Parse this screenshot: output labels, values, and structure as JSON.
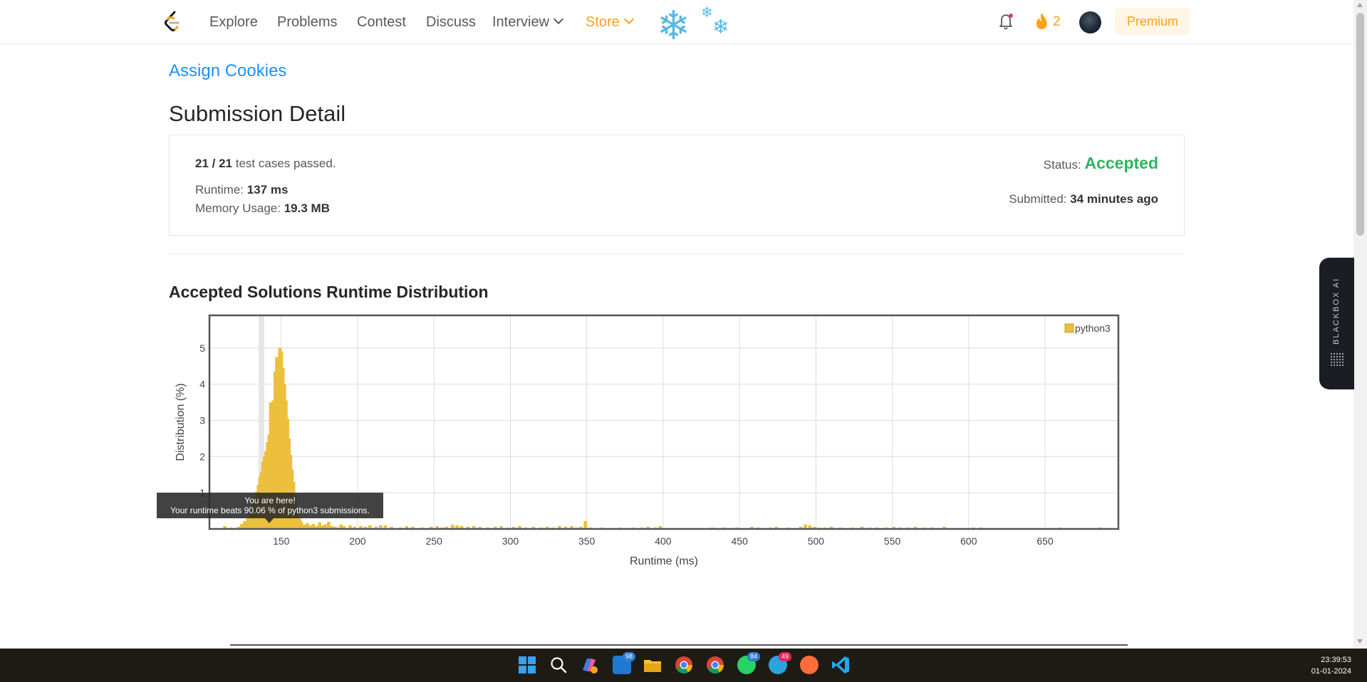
{
  "nav": {
    "items": [
      "Explore",
      "Problems",
      "Contest",
      "Discuss",
      "Interview",
      "Store"
    ],
    "streak": "2",
    "premium": "Premium",
    "store_color": "#ffa116"
  },
  "submission": {
    "problem": "Assign Cookies",
    "title": "Submission Detail",
    "passed": "21 / 21",
    "passed_suffix": "test cases passed.",
    "runtime_label": "Runtime:",
    "runtime_value": "137 ms",
    "memory_label": "Memory Usage:",
    "memory_value": "19.3 MB",
    "status_label": "Status:",
    "status_value": "Accepted",
    "submitted_label": "Submitted:",
    "submitted_value": "34 minutes ago"
  },
  "section_title": "Accepted Solutions Runtime Distribution",
  "tooltip": {
    "line1": "You are here!",
    "line2": "Your runtime beats 90.06 % of python3 submissions."
  },
  "chart_data": {
    "type": "bar",
    "xlabel": "Runtime (ms)",
    "ylabel": "Distribution (%)",
    "xlim": [
      103,
      698
    ],
    "ylim": [
      0,
      5.9
    ],
    "xticks": [
      150,
      200,
      250,
      300,
      350,
      400,
      450,
      500,
      550,
      600,
      650
    ],
    "yticks": [
      1,
      2,
      3,
      4,
      5
    ],
    "grid": true,
    "legend": "top-right",
    "series": [
      {
        "name": "python3",
        "color": "#ecbf3c"
      }
    ],
    "highlight_x": 137,
    "bar_width": 2,
    "points": [
      [
        113,
        0.08
      ],
      [
        117,
        0.04
      ],
      [
        122,
        0.06
      ],
      [
        124,
        0.14
      ],
      [
        125,
        0.1
      ],
      [
        126,
        0.22
      ],
      [
        128,
        0.3
      ],
      [
        130,
        0.42
      ],
      [
        131,
        0.6
      ],
      [
        132,
        0.72
      ],
      [
        133,
        0.88
      ],
      [
        134,
        1.04
      ],
      [
        135,
        1.22
      ],
      [
        136,
        1.45
      ],
      [
        137,
        1.58
      ],
      [
        138,
        1.85
      ],
      [
        139,
        2.0
      ],
      [
        140,
        2.15
      ],
      [
        141,
        2.4
      ],
      [
        142,
        2.6
      ],
      [
        143,
        3.5
      ],
      [
        144,
        3.1
      ],
      [
        145,
        3.55
      ],
      [
        146,
        4.35
      ],
      [
        147,
        4.75
      ],
      [
        148,
        4.6
      ],
      [
        149,
        5.0
      ],
      [
        150,
        4.9
      ],
      [
        151,
        4.45
      ],
      [
        152,
        4.0
      ],
      [
        153,
        3.55
      ],
      [
        154,
        3.05
      ],
      [
        155,
        2.5
      ],
      [
        156,
        2.05
      ],
      [
        157,
        1.65
      ],
      [
        158,
        1.3
      ],
      [
        159,
        0.95
      ],
      [
        160,
        0.62
      ],
      [
        161,
        0.36
      ],
      [
        162,
        0.28
      ],
      [
        163,
        0.2
      ],
      [
        165,
        0.12
      ],
      [
        167,
        0.16
      ],
      [
        169,
        0.1
      ],
      [
        171,
        0.14
      ],
      [
        173,
        0.08
      ],
      [
        175,
        0.18
      ],
      [
        177,
        0.1
      ],
      [
        179,
        0.13
      ],
      [
        181,
        0.2
      ],
      [
        183,
        0.08
      ],
      [
        185,
        0.06
      ],
      [
        187,
        0.04
      ],
      [
        189,
        0.12
      ],
      [
        191,
        0.08
      ],
      [
        195,
        0.1
      ],
      [
        198,
        0.06
      ],
      [
        202,
        0.08
      ],
      [
        205,
        0.06
      ],
      [
        208,
        0.1
      ],
      [
        212,
        0.06
      ],
      [
        215,
        0.1
      ],
      [
        218,
        0.1
      ],
      [
        222,
        0.06
      ],
      [
        228,
        0.04
      ],
      [
        232,
        0.08
      ],
      [
        236,
        0.06
      ],
      [
        242,
        0.04
      ],
      [
        248,
        0.06
      ],
      [
        252,
        0.08
      ],
      [
        255,
        0.04
      ],
      [
        258,
        0.06
      ],
      [
        262,
        0.12
      ],
      [
        265,
        0.1
      ],
      [
        268,
        0.08
      ],
      [
        272,
        0.06
      ],
      [
        276,
        0.08
      ],
      [
        280,
        0.06
      ],
      [
        285,
        0.04
      ],
      [
        290,
        0.06
      ],
      [
        294,
        0.08
      ],
      [
        298,
        0.04
      ],
      [
        302,
        0.06
      ],
      [
        306,
        0.08
      ],
      [
        310,
        0.04
      ],
      [
        315,
        0.06
      ],
      [
        320,
        0.04
      ],
      [
        324,
        0.06
      ],
      [
        328,
        0.04
      ],
      [
        332,
        0.08
      ],
      [
        336,
        0.06
      ],
      [
        340,
        0.08
      ],
      [
        343,
        0.04
      ],
      [
        346,
        0.06
      ],
      [
        349,
        0.22
      ],
      [
        352,
        0.04
      ],
      [
        360,
        0.04
      ],
      [
        372,
        0.04
      ],
      [
        380,
        0.04
      ],
      [
        386,
        0.04
      ],
      [
        390,
        0.06
      ],
      [
        395,
        0.04
      ],
      [
        398,
        0.08
      ],
      [
        432,
        0.04
      ],
      [
        440,
        0.04
      ],
      [
        448,
        0.04
      ],
      [
        458,
        0.06
      ],
      [
        462,
        0.04
      ],
      [
        470,
        0.04
      ],
      [
        474,
        0.06
      ],
      [
        482,
        0.04
      ],
      [
        490,
        0.06
      ],
      [
        493,
        0.12
      ],
      [
        496,
        0.1
      ],
      [
        499,
        0.06
      ],
      [
        502,
        0.04
      ],
      [
        506,
        0.04
      ],
      [
        510,
        0.06
      ],
      [
        516,
        0.04
      ],
      [
        524,
        0.04
      ],
      [
        530,
        0.06
      ],
      [
        535,
        0.04
      ],
      [
        540,
        0.04
      ],
      [
        546,
        0.04
      ],
      [
        551,
        0.06
      ],
      [
        555,
        0.04
      ],
      [
        560,
        0.04
      ],
      [
        565,
        0.06
      ],
      [
        571,
        0.04
      ],
      [
        576,
        0.04
      ],
      [
        584,
        0.06
      ],
      [
        603,
        0.04
      ],
      [
        608,
        0.04
      ],
      [
        660,
        0.04
      ],
      [
        686,
        0.04
      ]
    ]
  },
  "blackbox": "BLACKBOX AI",
  "taskbar": {
    "badges": {
      "mail": "98",
      "whatsapp": "84",
      "telegram": "49"
    },
    "time": "23:39:53",
    "date": "01-01-2024"
  }
}
